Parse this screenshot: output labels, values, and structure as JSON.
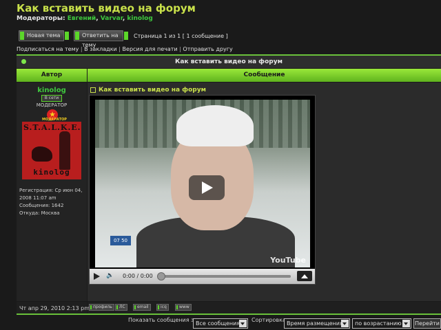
{
  "topic": {
    "title": "Как вставить видео на форум",
    "moderators_label": "Модераторы:",
    "moderators": [
      "Евгений",
      "Varvar",
      "kinolog"
    ]
  },
  "actions": {
    "new_topic": "Новая тема",
    "reply": "Ответить на тему",
    "page_info": "Страница 1 из 1   [ 1 сообщение ]"
  },
  "topic_links": [
    "Подписаться на тему",
    "В закладки",
    "Версия для печати",
    "Отправить другу"
  ],
  "table": {
    "header_title": "Как вставить видео на форум",
    "col_author": "Автор",
    "col_message": "Сообщение"
  },
  "post": {
    "author": "kinolog",
    "online": "В сети",
    "role": "МОДЕРАТОР",
    "rank_tag": "МОДЕРАТОР",
    "avatar_text_top": "S.T.A.L.K.E.R",
    "avatar_text_bottom": "kinolog",
    "registered": "Регистрация: Ср июн 04, 2008 11:07 am",
    "posts": "Сообщения: 1642",
    "from": "Откуда: Москва",
    "title": "Как вставить видео на форум",
    "video": {
      "time": "0:00 / 0:00",
      "channel_tag": "07 50",
      "watermark": "YouTube",
      "progress": 0
    },
    "date": "Чт апр 29, 2010 2:13 pm",
    "buttons": [
      "профиль",
      "ЛС",
      "email",
      "icq",
      "www"
    ]
  },
  "footer": {
    "show_label": "Показать сообщения за:",
    "show_value": "Все сообщения",
    "sort_label": "Сортировка",
    "sort_value": "Время размещения",
    "order_value": "по возрастанию",
    "go": "Перейти"
  }
}
